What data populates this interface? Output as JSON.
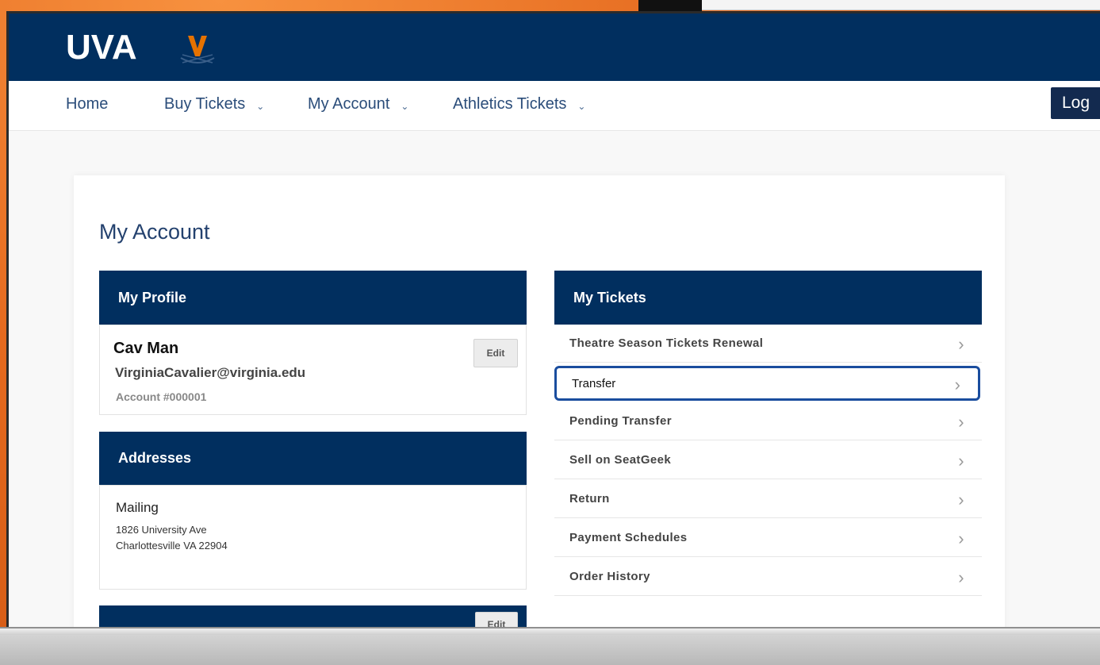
{
  "brand": {
    "logo_text": "UVA",
    "logo_icon": "v-sabres-icon"
  },
  "nav": {
    "home": "Home",
    "buy_tickets": "Buy Tickets",
    "my_account": "My Account",
    "athletics_tickets": "Athletics Tickets",
    "login": "Log"
  },
  "page": {
    "title": "My Account"
  },
  "profile": {
    "header": "My Profile",
    "name": "Cav Man",
    "email": "VirginiaCavalier@virginia.edu",
    "account": "Account #000001",
    "edit_label": "Edit"
  },
  "addresses": {
    "header": "Addresses",
    "type": "Mailing",
    "line1": "1826 University Ave",
    "line2": "Charlottesville VA 22904"
  },
  "lower_panel": {
    "edit_label": "Edit"
  },
  "tickets": {
    "header": "My Tickets",
    "items": [
      {
        "label": "Theatre Season Tickets Renewal"
      },
      {
        "label": "Transfer",
        "selected": true
      },
      {
        "label": "Pending Transfer"
      },
      {
        "label": "Sell on SeatGeek"
      },
      {
        "label": "Return"
      },
      {
        "label": "Payment Schedules"
      },
      {
        "label": "Order History"
      }
    ]
  },
  "colors": {
    "brand_navy": "#012f5f",
    "accent_orange": "#e57200",
    "selection_blue": "#1a4d9e"
  }
}
